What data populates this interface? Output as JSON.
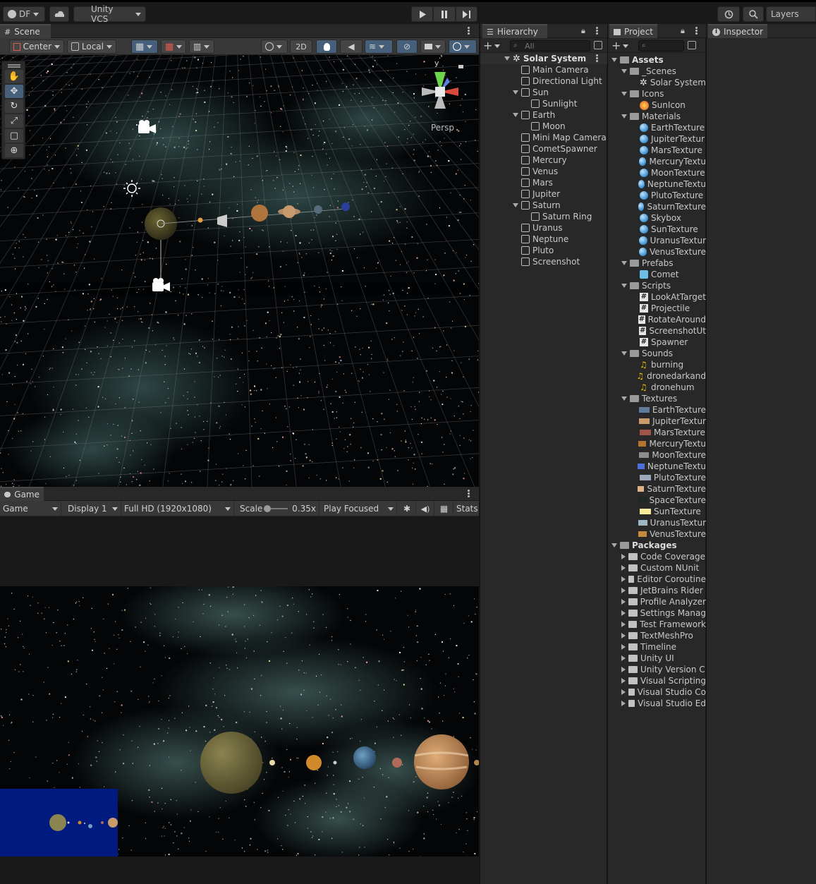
{
  "toolbar": {
    "account": "DF",
    "vcs": "Unity VCS",
    "layers": "Layers"
  },
  "scene": {
    "tab": "Scene",
    "pivot": "Center",
    "space": "Local",
    "mode_2d": "2D",
    "persp": "Persp",
    "axis_y": "y"
  },
  "game": {
    "tab": "Game",
    "view": "Game",
    "display": "Display 1",
    "resolution": "Full HD (1920x1080)",
    "scale_label": "Scale",
    "scale_value": "0.35x",
    "play_mode": "Play Focused",
    "stats": "Stats"
  },
  "hierarchy": {
    "tab": "Hierarchy",
    "search_placeholder": "All",
    "scene_name": "Solar System",
    "items": [
      {
        "label": "Main Camera",
        "depth": 1,
        "fold": ""
      },
      {
        "label": "Directional Light",
        "depth": 1,
        "fold": ""
      },
      {
        "label": "Sun",
        "depth": 1,
        "fold": "open"
      },
      {
        "label": "Sunlight",
        "depth": 2,
        "fold": ""
      },
      {
        "label": "Earth",
        "depth": 1,
        "fold": "open"
      },
      {
        "label": "Moon",
        "depth": 2,
        "fold": ""
      },
      {
        "label": "Mini Map Camera",
        "depth": 1,
        "fold": ""
      },
      {
        "label": "CometSpawner",
        "depth": 1,
        "fold": ""
      },
      {
        "label": "Mercury",
        "depth": 1,
        "fold": ""
      },
      {
        "label": "Venus",
        "depth": 1,
        "fold": ""
      },
      {
        "label": "Mars",
        "depth": 1,
        "fold": ""
      },
      {
        "label": "Jupiter",
        "depth": 1,
        "fold": ""
      },
      {
        "label": "Saturn",
        "depth": 1,
        "fold": "open"
      },
      {
        "label": "Saturn Ring",
        "depth": 2,
        "fold": ""
      },
      {
        "label": "Uranus",
        "depth": 1,
        "fold": ""
      },
      {
        "label": "Neptune",
        "depth": 1,
        "fold": ""
      },
      {
        "label": "Pluto",
        "depth": 1,
        "fold": ""
      },
      {
        "label": "Screenshot",
        "depth": 1,
        "fold": ""
      }
    ]
  },
  "project": {
    "tab": "Project",
    "items": [
      {
        "label": "Assets",
        "depth": 0,
        "fold": "open",
        "icon": "folder",
        "bold": true
      },
      {
        "label": "_Scenes",
        "depth": 1,
        "fold": "open",
        "icon": "folder"
      },
      {
        "label": "Solar System",
        "depth": 2,
        "fold": "",
        "icon": "unity-scene"
      },
      {
        "label": "Icons",
        "depth": 1,
        "fold": "open",
        "icon": "folder"
      },
      {
        "label": "SunIcon",
        "depth": 2,
        "fold": "",
        "icon": "sun-image"
      },
      {
        "label": "Materials",
        "depth": 1,
        "fold": "open",
        "icon": "folder"
      },
      {
        "label": "EarthTexture",
        "depth": 2,
        "fold": "",
        "icon": "material"
      },
      {
        "label": "JupiterTextur",
        "depth": 2,
        "fold": "",
        "icon": "material"
      },
      {
        "label": "MarsTexture",
        "depth": 2,
        "fold": "",
        "icon": "material"
      },
      {
        "label": "MercuryTextu",
        "depth": 2,
        "fold": "",
        "icon": "material"
      },
      {
        "label": "MoonTexture",
        "depth": 2,
        "fold": "",
        "icon": "material"
      },
      {
        "label": "NeptuneTextu",
        "depth": 2,
        "fold": "",
        "icon": "material"
      },
      {
        "label": "PlutoTexture",
        "depth": 2,
        "fold": "",
        "icon": "material"
      },
      {
        "label": "SaturnTexture",
        "depth": 2,
        "fold": "",
        "icon": "material"
      },
      {
        "label": "Skybox",
        "depth": 2,
        "fold": "",
        "icon": "material"
      },
      {
        "label": "SunTexture",
        "depth": 2,
        "fold": "",
        "icon": "material"
      },
      {
        "label": "UranusTextur",
        "depth": 2,
        "fold": "",
        "icon": "material"
      },
      {
        "label": "VenusTexture",
        "depth": 2,
        "fold": "",
        "icon": "material"
      },
      {
        "label": "Prefabs",
        "depth": 1,
        "fold": "open",
        "icon": "folder"
      },
      {
        "label": "Comet",
        "depth": 2,
        "fold": "",
        "icon": "prefab"
      },
      {
        "label": "Scripts",
        "depth": 1,
        "fold": "open",
        "icon": "folder"
      },
      {
        "label": "LookAtTarget",
        "depth": 2,
        "fold": "",
        "icon": "script"
      },
      {
        "label": "Projectile",
        "depth": 2,
        "fold": "",
        "icon": "script"
      },
      {
        "label": "RotateAround",
        "depth": 2,
        "fold": "",
        "icon": "script"
      },
      {
        "label": "ScreenshotUt",
        "depth": 2,
        "fold": "",
        "icon": "script"
      },
      {
        "label": "Spawner",
        "depth": 2,
        "fold": "",
        "icon": "script"
      },
      {
        "label": "Sounds",
        "depth": 1,
        "fold": "open",
        "icon": "folder"
      },
      {
        "label": "burning",
        "depth": 2,
        "fold": "",
        "icon": "audio"
      },
      {
        "label": "dronedarkand",
        "depth": 2,
        "fold": "",
        "icon": "audio"
      },
      {
        "label": "dronehum",
        "depth": 2,
        "fold": "",
        "icon": "audio"
      },
      {
        "label": "Textures",
        "depth": 1,
        "fold": "open",
        "icon": "folder"
      },
      {
        "label": "EarthTexture",
        "depth": 2,
        "fold": "",
        "icon": "texture",
        "swatch": "#5f7d9a"
      },
      {
        "label": "JupiterTextur",
        "depth": 2,
        "fold": "",
        "icon": "texture",
        "swatch": "#c99a6c"
      },
      {
        "label": "MarsTexture",
        "depth": 2,
        "fold": "",
        "icon": "texture",
        "swatch": "#a0554a"
      },
      {
        "label": "MercuryTextu",
        "depth": 2,
        "fold": "",
        "icon": "texture",
        "swatch": "#b4742e"
      },
      {
        "label": "MoonTexture",
        "depth": 2,
        "fold": "",
        "icon": "texture",
        "swatch": "#8d8d8d"
      },
      {
        "label": "NeptuneTextu",
        "depth": 2,
        "fold": "",
        "icon": "texture",
        "swatch": "#4d6fd8"
      },
      {
        "label": "PlutoTexture",
        "depth": 2,
        "fold": "",
        "icon": "texture",
        "swatch": "#9aa7b8"
      },
      {
        "label": "SaturnTexture",
        "depth": 2,
        "fold": "",
        "icon": "texture",
        "swatch": "#e0b28a"
      },
      {
        "label": "SpaceTexture",
        "depth": 2,
        "fold": "",
        "icon": "texture",
        "swatch": "#1a2a22"
      },
      {
        "label": "SunTexture",
        "depth": 2,
        "fold": "",
        "icon": "texture",
        "swatch": "#f8ea9a"
      },
      {
        "label": "UranusTextur",
        "depth": 2,
        "fold": "",
        "icon": "texture",
        "swatch": "#9cb6c8"
      },
      {
        "label": "VenusTexture",
        "depth": 2,
        "fold": "",
        "icon": "texture",
        "swatch": "#c68a3a"
      },
      {
        "label": "Packages",
        "depth": 0,
        "fold": "open",
        "icon": "folder",
        "bold": true
      },
      {
        "label": "Code Coverage",
        "depth": 1,
        "fold": "closed",
        "icon": "folder"
      },
      {
        "label": "Custom NUnit",
        "depth": 1,
        "fold": "closed",
        "icon": "folder"
      },
      {
        "label": "Editor Coroutine",
        "depth": 1,
        "fold": "closed",
        "icon": "folder"
      },
      {
        "label": "JetBrains Rider",
        "depth": 1,
        "fold": "closed",
        "icon": "folder"
      },
      {
        "label": "Profile Analyzer",
        "depth": 1,
        "fold": "closed",
        "icon": "folder"
      },
      {
        "label": "Settings Manag",
        "depth": 1,
        "fold": "closed",
        "icon": "folder"
      },
      {
        "label": "Test Framework",
        "depth": 1,
        "fold": "closed",
        "icon": "folder"
      },
      {
        "label": "TextMeshPro",
        "depth": 1,
        "fold": "closed",
        "icon": "folder"
      },
      {
        "label": "Timeline",
        "depth": 1,
        "fold": "closed",
        "icon": "folder"
      },
      {
        "label": "Unity UI",
        "depth": 1,
        "fold": "closed",
        "icon": "folder"
      },
      {
        "label": "Unity Version C",
        "depth": 1,
        "fold": "closed",
        "icon": "folder"
      },
      {
        "label": "Visual Scripting",
        "depth": 1,
        "fold": "closed",
        "icon": "folder"
      },
      {
        "label": "Visual Studio Co",
        "depth": 1,
        "fold": "closed",
        "icon": "folder"
      },
      {
        "label": "Visual Studio Ed",
        "depth": 1,
        "fold": "closed",
        "icon": "folder"
      }
    ]
  },
  "inspector": {
    "tab": "Inspector"
  },
  "colors": {
    "selection": "#46607c",
    "minimap_bg": "#001a80",
    "folder_icon": "#c2c2c2",
    "audio_icon": "#f2c200"
  }
}
